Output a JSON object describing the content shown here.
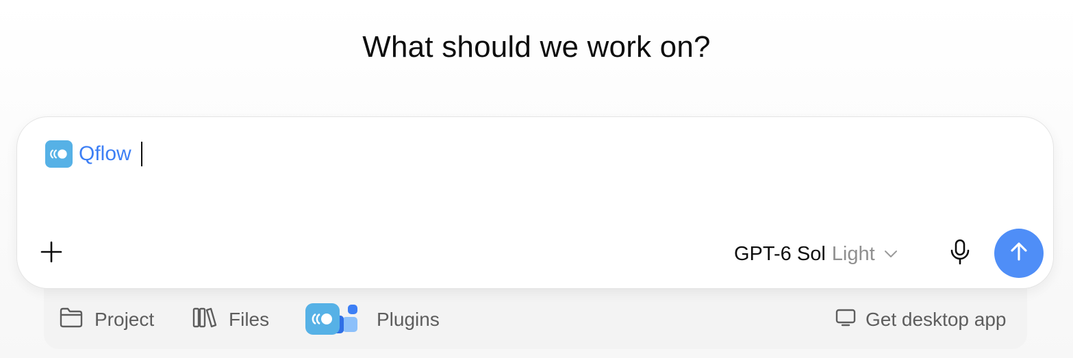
{
  "heading": "What should we work on?",
  "composer": {
    "app_chip": {
      "label": "Qflow",
      "icon": "qflow-app-icon"
    },
    "input_value": "",
    "add_icon": "plus-icon",
    "model": {
      "name": "GPT-6 Sol",
      "variant": "Light",
      "icon": "chevron-down-icon"
    },
    "mic_icon": "microphone-icon",
    "send_icon": "arrow-up-icon"
  },
  "toolbar": {
    "project_label": "Project",
    "files_label": "Files",
    "plugins_label": "Plugins",
    "desktop_label": "Get desktop app"
  },
  "colors": {
    "accent": "#4f8ef7",
    "chip_text": "#3d7ff5",
    "app_icon": "#56b1e6"
  }
}
